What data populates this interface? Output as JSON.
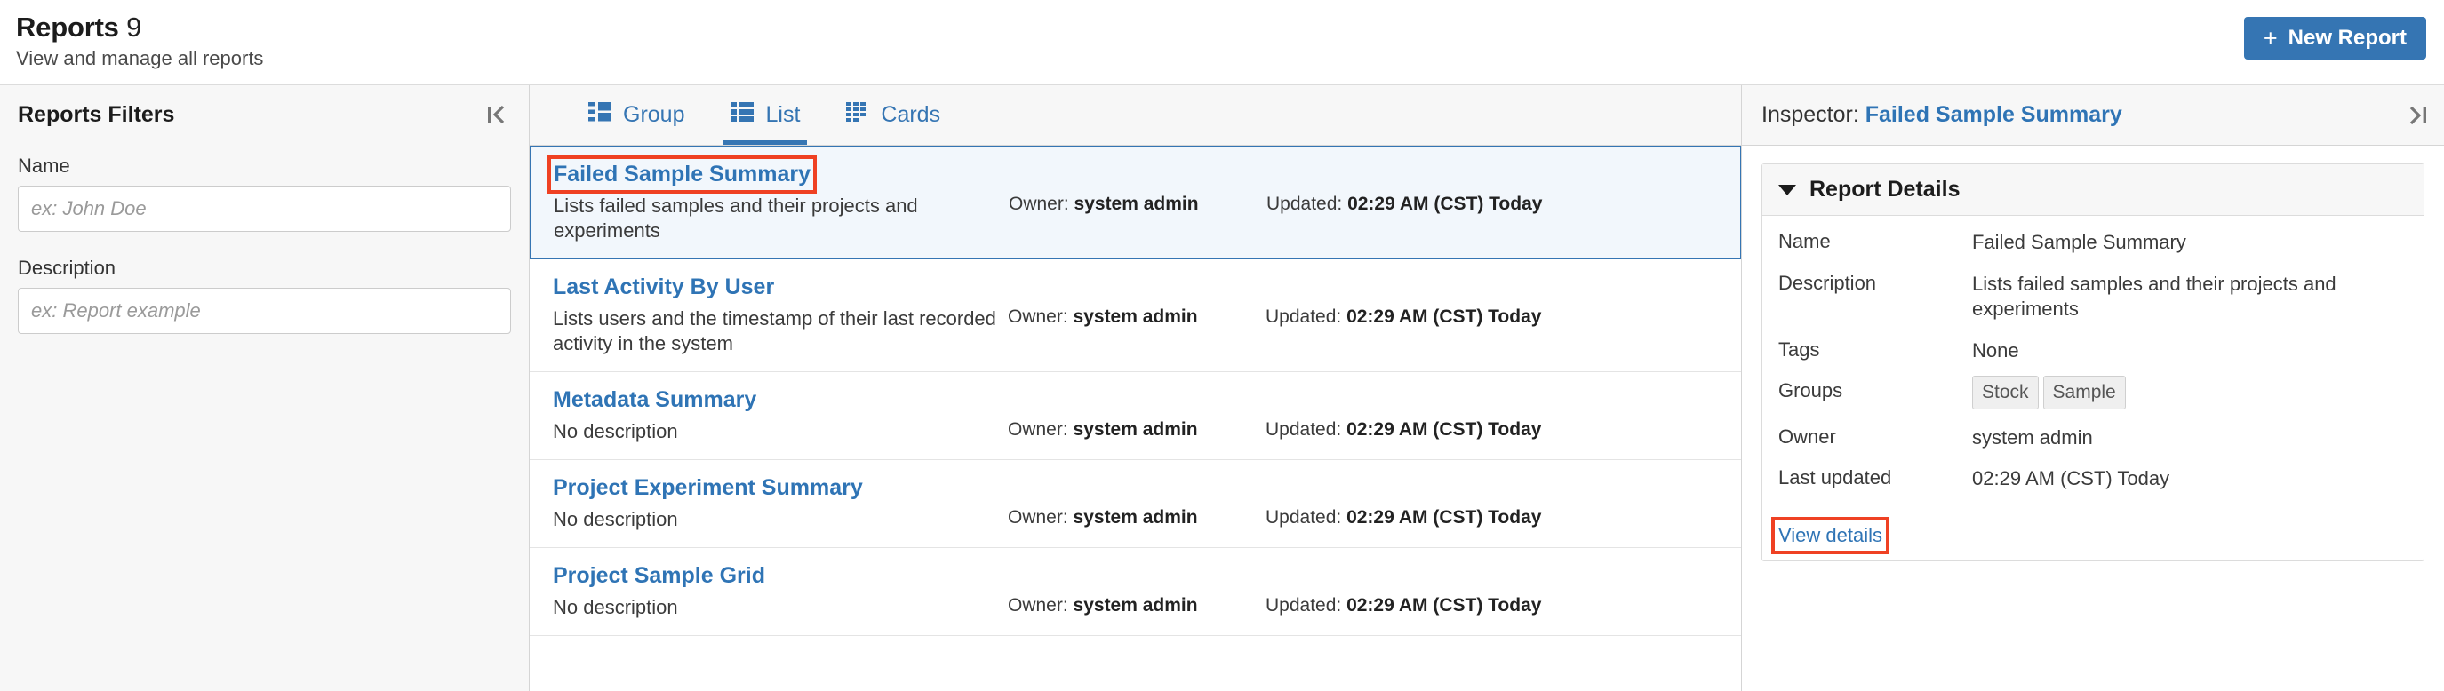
{
  "header": {
    "title": "Reports",
    "count": "9",
    "subtitle": "View and manage all reports",
    "new_report_label": "New Report",
    "plus_glyph": "+",
    "accent_color": "#3575b3"
  },
  "filters": {
    "title": "Reports Filters",
    "collapse_icon": "collapse-left-icon",
    "name": {
      "label": "Name",
      "value": "",
      "placeholder": "ex: John Doe"
    },
    "description": {
      "label": "Description",
      "value": "",
      "placeholder": "ex: Report example"
    }
  },
  "tabs": [
    {
      "label": "Group",
      "icon": "group-view-icon",
      "active": false
    },
    {
      "label": "List",
      "icon": "list-view-icon",
      "active": true
    },
    {
      "label": "Cards",
      "icon": "cards-view-icon",
      "active": true
    }
  ],
  "list": {
    "owner_prefix": "Owner:",
    "updated_prefix": "Updated:",
    "rows": [
      {
        "name": "Failed Sample Summary",
        "description": "Lists failed samples and their projects and experiments",
        "owner": "system admin",
        "updated": "02:29 AM (CST) Today",
        "selected": true
      },
      {
        "name": "Last Activity By User",
        "description": "Lists users and the timestamp of their last recorded activity in the system",
        "owner": "system admin",
        "updated": "02:29 AM (CST) Today",
        "selected": false
      },
      {
        "name": "Metadata Summary",
        "description": "No description",
        "owner": "system admin",
        "updated": "02:29 AM (CST) Today",
        "selected": false
      },
      {
        "name": "Project Experiment Summary",
        "description": "No description",
        "owner": "system admin",
        "updated": "02:29 AM (CST) Today",
        "selected": false
      },
      {
        "name": "Project Sample Grid",
        "description": "No description",
        "owner": "system admin",
        "updated": "02:29 AM (CST) Today",
        "selected": false
      }
    ]
  },
  "inspector": {
    "label": "Inspector:",
    "target_name": "Failed Sample Summary",
    "collapse_icon": "collapse-right-icon",
    "card": {
      "title": "Report Details",
      "caret": "caret-down-icon",
      "rows": [
        {
          "key": "Name",
          "value": "Failed Sample Summary",
          "type": "text"
        },
        {
          "key": "Description",
          "value": "Lists failed samples and their projects and experiments",
          "type": "text"
        },
        {
          "key": "Tags",
          "value": "None",
          "type": "text"
        },
        {
          "key": "Groups",
          "value": "",
          "type": "chips",
          "chips": [
            "Stock",
            "Sample"
          ]
        },
        {
          "key": "Owner",
          "value": "system admin",
          "type": "text"
        },
        {
          "key": "Last updated",
          "value": "02:29 AM (CST) Today",
          "type": "text"
        }
      ],
      "view_details_label": "View details"
    }
  },
  "highlight_color": "#ef4123"
}
